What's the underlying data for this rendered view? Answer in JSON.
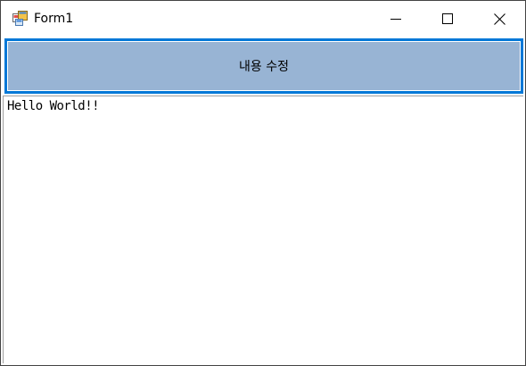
{
  "window": {
    "title": "Form1",
    "icon": "winforms-app-icon"
  },
  "caption_buttons": {
    "minimize_icon": "minimize-icon",
    "maximize_icon": "maximize-icon",
    "close_icon": "close-icon"
  },
  "main": {
    "button_label": "내용 수정",
    "textbox_value": "Hello World!!"
  },
  "colors": {
    "button_fill": "#98b4d4",
    "button_focus_border": "#0078d7"
  }
}
